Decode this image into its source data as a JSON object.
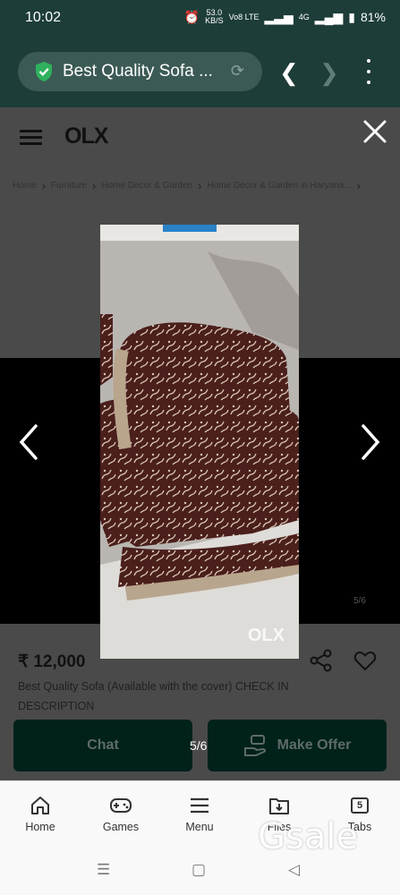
{
  "status_bar": {
    "time": "10:02",
    "net_speed_top": "53.0",
    "net_speed_bottom": "KB/S",
    "volte": "Vo8 LTE",
    "signal_label": "4G",
    "battery": "81%"
  },
  "browser": {
    "url_title": "Best Quality Sofa ...",
    "secure_icon": "shield-check-icon",
    "accent_color": "#1d3d38"
  },
  "page": {
    "logo": "OLX",
    "breadcrumbs": [
      "Home",
      "Furniture",
      "Home Decor & Garden",
      "Home Decor & Garden in Haryana..."
    ],
    "slide_counter": "5/6",
    "image_index": "5/6",
    "watermark": "OLX",
    "price": "₹ 12,000",
    "description": "Best Quality Sofa (Available with the cover) CHECK IN DESCRIPTION",
    "chat_label": "Chat",
    "offer_label": "Make Offer"
  },
  "bottom_nav": {
    "items": [
      {
        "label": "Home",
        "icon": "home-icon"
      },
      {
        "label": "Games",
        "icon": "gamepad-icon"
      },
      {
        "label": "Menu",
        "icon": "menu-icon"
      },
      {
        "label": "Files",
        "icon": "download-folder-icon"
      },
      {
        "label": "Tabs",
        "icon": "tabs-icon"
      }
    ],
    "tabs_count": "5"
  },
  "overlay_watermark": "Gsale"
}
